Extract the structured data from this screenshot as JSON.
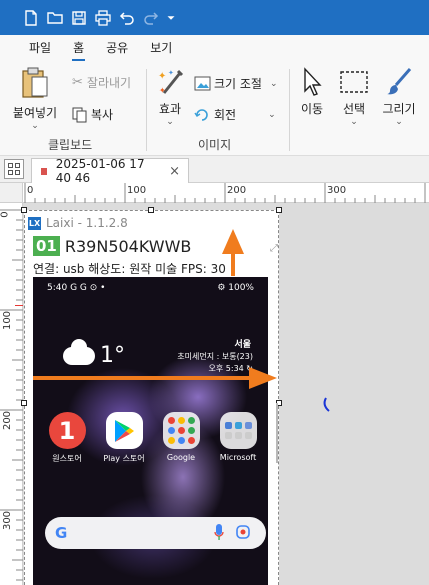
{
  "quick_access": {
    "icons": [
      "new-file-icon",
      "open-folder-icon",
      "save-icon",
      "print-icon",
      "undo-icon",
      "redo-icon",
      "customize-dropdown-icon"
    ]
  },
  "ribbon_tabs": [
    {
      "label": "파일",
      "active": false
    },
    {
      "label": "홈",
      "active": true
    },
    {
      "label": "공유",
      "active": false
    },
    {
      "label": "보기",
      "active": false
    }
  ],
  "ribbon": {
    "paste": "붙여넣기",
    "cut": "잘라내기",
    "copy": "복사",
    "clipboard_group": "클립보드",
    "effects": "효과",
    "resize": "크기 조절",
    "rotate": "회전",
    "image_group": "이미지",
    "move": "이동",
    "select": "선택",
    "draw": "그리기"
  },
  "document_tab": {
    "title": "2025-01-06 17 40 46",
    "close": "×"
  },
  "ruler": {
    "h_ticks": [
      "0",
      "100",
      "200",
      "300"
    ],
    "v_ticks": [
      "0",
      "100",
      "200",
      "300"
    ]
  },
  "laixi": {
    "logo": "LX",
    "app_name": "Laixi - 1.1.2.8",
    "device_index": "01",
    "device_id": "R39N504KWWB",
    "info": "연결: usb   해상도: 원작 미술   FPS: 30",
    "fullscreen_icon": "⤢"
  },
  "phone": {
    "status_left": "5:40 G G ⊙ •",
    "status_right": "⚙ 100%",
    "temperature": "1°",
    "city": "서울",
    "dust": "초미세먼지 : 보통(23)",
    "time": "오후 5:34 ↻",
    "apps": [
      {
        "label": "원스토어",
        "glyph": "1"
      },
      {
        "label": "Play 스토어",
        "glyph": "▶"
      },
      {
        "label": "Google",
        "glyph": ""
      },
      {
        "label": "Microsoft",
        "glyph": ""
      }
    ],
    "search_logo": "G"
  },
  "colors": {
    "accent": "#1f6fc2",
    "arrow": "#f07c1e",
    "mark": "#1a35d6"
  }
}
